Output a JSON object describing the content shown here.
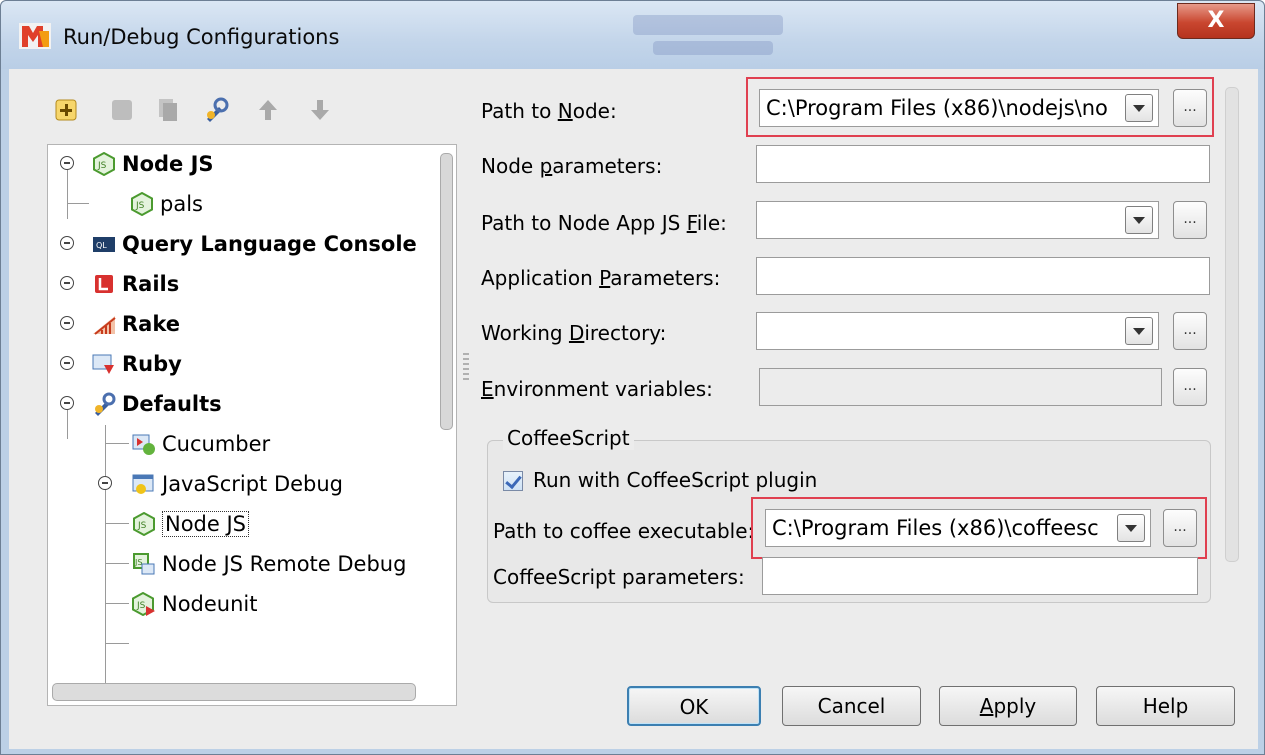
{
  "window": {
    "title": "Run/Debug Configurations",
    "close_label": "X"
  },
  "toolbar": {
    "icons": [
      "add-icon",
      "remove-icon",
      "copy-icon",
      "edit-defaults-icon",
      "move-up-icon",
      "move-down-icon"
    ]
  },
  "tree": {
    "items": [
      {
        "label": "Node JS",
        "icon": "nodejs-icon"
      },
      {
        "label": "pals",
        "icon": "nodejs-icon"
      },
      {
        "label": "Query Language Console",
        "icon": "query-console-icon"
      },
      {
        "label": "Rails",
        "icon": "rails-icon"
      },
      {
        "label": "Rake",
        "icon": "rake-icon"
      },
      {
        "label": "Ruby",
        "icon": "ruby-icon"
      },
      {
        "label": "Defaults",
        "icon": "wrench-icon"
      },
      {
        "label": "Cucumber",
        "icon": "cucumber-icon"
      },
      {
        "label": "JavaScript Debug",
        "icon": "js-debug-icon"
      },
      {
        "label": "Node JS",
        "icon": "nodejs-icon"
      },
      {
        "label": "Node JS Remote Debug",
        "icon": "nodejs-remote-icon"
      },
      {
        "label": "Nodeunit",
        "icon": "nodeunit-icon"
      }
    ]
  },
  "form": {
    "path_to_node": {
      "label_pre": "Path to ",
      "label_key": "N",
      "label_post": "ode:",
      "value": "C:\\Program Files (x86)\\nodejs\\no"
    },
    "node_parameters": {
      "label_pre": "Node ",
      "label_key": "p",
      "label_post": "arameters:",
      "value": ""
    },
    "app_js_file": {
      "label_pre": "Path to Node App JS ",
      "label_key": "F",
      "label_post": "ile:",
      "value": ""
    },
    "app_parameters": {
      "label_pre": "Application ",
      "label_key": "P",
      "label_post": "arameters:",
      "value": ""
    },
    "working_dir": {
      "label_pre": "Working ",
      "label_key": "D",
      "label_post": "irectory:",
      "value": ""
    },
    "env_vars": {
      "label_pre": "",
      "label_key": "E",
      "label_post": "nvironment variables:",
      "value": ""
    }
  },
  "coffeescript": {
    "group_title": "CoffeeScript",
    "run_with_plugin_label": "Run with CoffeeScript plugin",
    "run_with_plugin_checked": true,
    "exec_label": "Path to coffee executable:",
    "exec_value": "C:\\Program Files (x86)\\coffeesc",
    "params_label": "CoffeeScript parameters:",
    "params_value": ""
  },
  "buttons": {
    "ok": "OK",
    "cancel": "Cancel",
    "apply_key": "A",
    "apply_rest": "pply",
    "help": "Help"
  },
  "colors": {
    "highlight_box": "#e04050",
    "title_bar": "#c3d5ea",
    "close_button": "#c9462f"
  }
}
